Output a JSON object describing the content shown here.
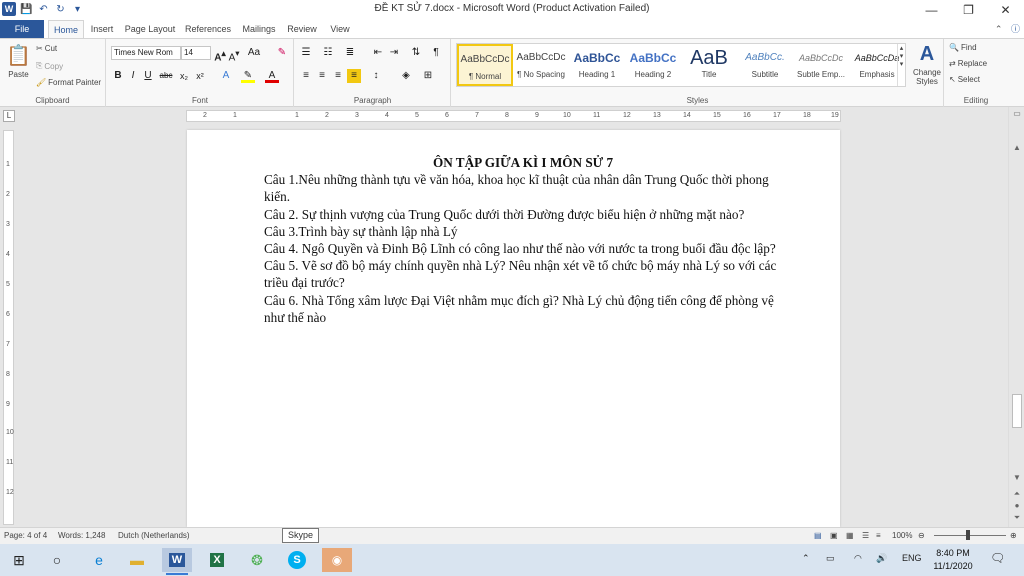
{
  "window": {
    "title": "ĐỀ KT SỬ 7.docx - Microsoft Word (Product Activation Failed)",
    "minimize": "—",
    "restore": "❐",
    "close": "✕"
  },
  "tabs": [
    "File",
    "Home",
    "Insert",
    "Page Layout",
    "References",
    "Mailings",
    "Review",
    "View"
  ],
  "ribbon": {
    "clipboard": {
      "paste": "Paste",
      "cut": "Cut",
      "copy": "Copy",
      "format_painter": "Format Painter",
      "label": "Clipboard"
    },
    "font": {
      "name": "Times New Rom",
      "size": "14",
      "label": "Font"
    },
    "paragraph": {
      "label": "Paragraph"
    },
    "styles": {
      "label": "Styles",
      "items": [
        {
          "preview": "AaBbCcDc",
          "name": "¶ Normal"
        },
        {
          "preview": "AaBbCcDc",
          "name": "¶ No Spacing"
        },
        {
          "preview": "AaBbCc",
          "name": "Heading 1"
        },
        {
          "preview": "AaBbCc",
          "name": "Heading 2"
        },
        {
          "preview": "AaB",
          "name": "Title"
        },
        {
          "preview": "AaBbCc.",
          "name": "Subtitle"
        },
        {
          "preview": "AaBbCcDc",
          "name": "Subtle Emp..."
        },
        {
          "preview": "AaBbCcDa",
          "name": "Emphasis"
        }
      ],
      "change_styles": "Change Styles"
    },
    "editing": {
      "find": "Find",
      "replace": "Replace",
      "select": "Select",
      "label": "Editing"
    }
  },
  "document": {
    "title": "ÔN TẬP GIỮA KÌ I MÔN SỬ 7",
    "paragraphs": [
      "Câu 1.Nêu những thành tựu về văn hóa, khoa học kĩ thuật của nhân dân Trung Quốc thời phong kiến.",
      "Câu 2. Sự thịnh vượng của Trung Quốc dưới thời Đường được biểu hiện ở những mặt nào?",
      "Câu 3.Trình bày sự thành lập nhà Lý",
      "Câu 4. Ngô Quyền và Đinh Bộ Lĩnh có công lao như thế nào với nước ta trong buổi đầu độc lập?",
      "Câu 5. Vẽ sơ đồ bộ máy chính quyền nhà Lý? Nêu nhận xét về tổ chức bộ máy nhà Lý so với các triều đại trước?",
      "Câu 6. Nhà Tống xâm lược Đại Việt nhằm mục đích gì? Nhà Lý chủ động tiến công để phòng vệ như thế nào"
    ]
  },
  "status": {
    "page": "Page: 4 of 4",
    "words": "Words: 1,248",
    "language": "Dutch (Netherlands)",
    "tooltip": "Skype",
    "zoom": "100%"
  },
  "taskbar": {
    "lang": "ENG",
    "time": "8:40 PM",
    "date": "11/1/2020"
  }
}
